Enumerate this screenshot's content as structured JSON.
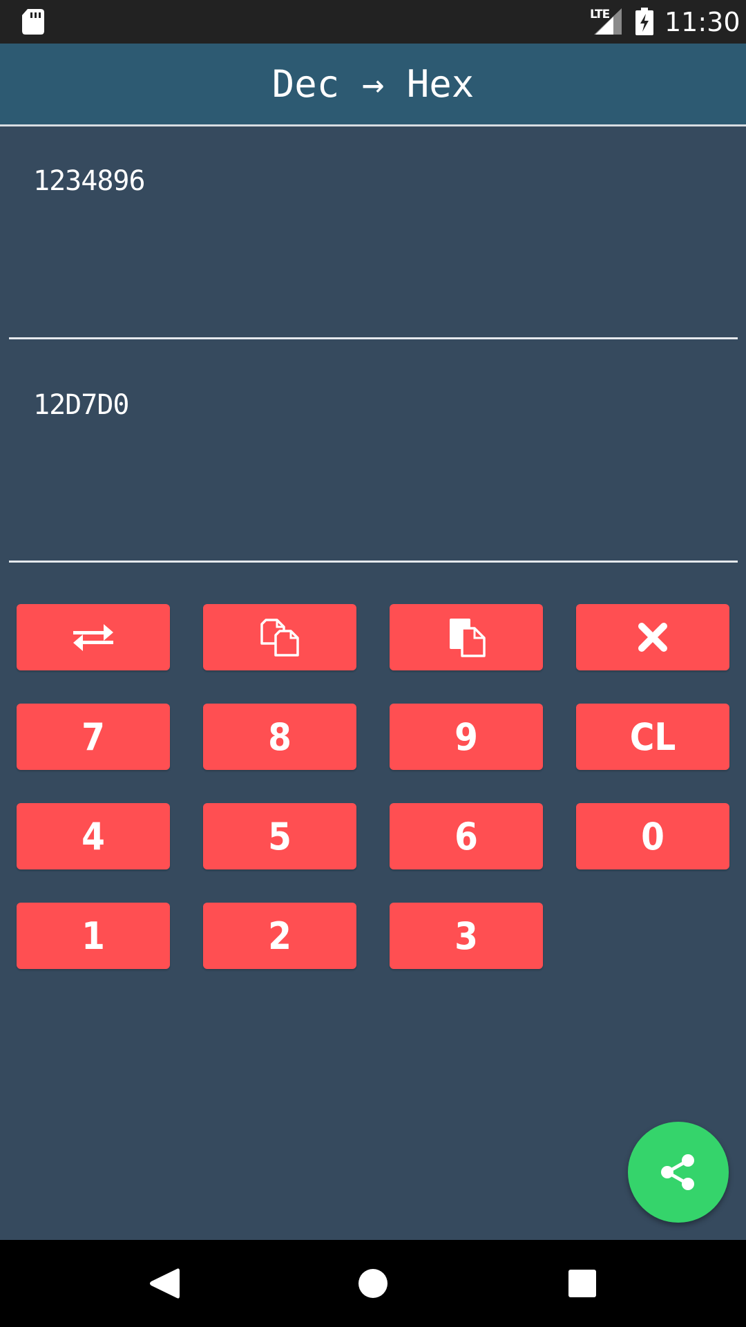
{
  "status_bar": {
    "network": "LTE",
    "time": "11:30",
    "icons": [
      "sd-card-icon",
      "signal-icon",
      "battery-charging-icon"
    ]
  },
  "app_bar": {
    "title": "Dec → Hex"
  },
  "input": {
    "value": "1234896"
  },
  "output": {
    "value": "12D7D0"
  },
  "keypad": {
    "action_keys": [
      {
        "name": "swap-button",
        "icon": "swap-arrows-icon"
      },
      {
        "name": "copy-button",
        "icon": "copy-icon"
      },
      {
        "name": "paste-button",
        "icon": "paste-icon"
      },
      {
        "name": "delete-button",
        "icon": "close-icon"
      }
    ],
    "rows": [
      [
        "7",
        "8",
        "9",
        "CL"
      ],
      [
        "4",
        "5",
        "6",
        "0"
      ],
      [
        "1",
        "2",
        "3"
      ]
    ]
  },
  "fab": {
    "icon": "share-icon"
  },
  "nav_bar": {
    "buttons": [
      "back-icon",
      "home-icon",
      "recents-icon"
    ]
  },
  "colors": {
    "background": "#364a5e",
    "app_bar": "#2d5a72",
    "key": "#ff4f52",
    "fab": "#35d46b",
    "status_bar": "#222222"
  }
}
